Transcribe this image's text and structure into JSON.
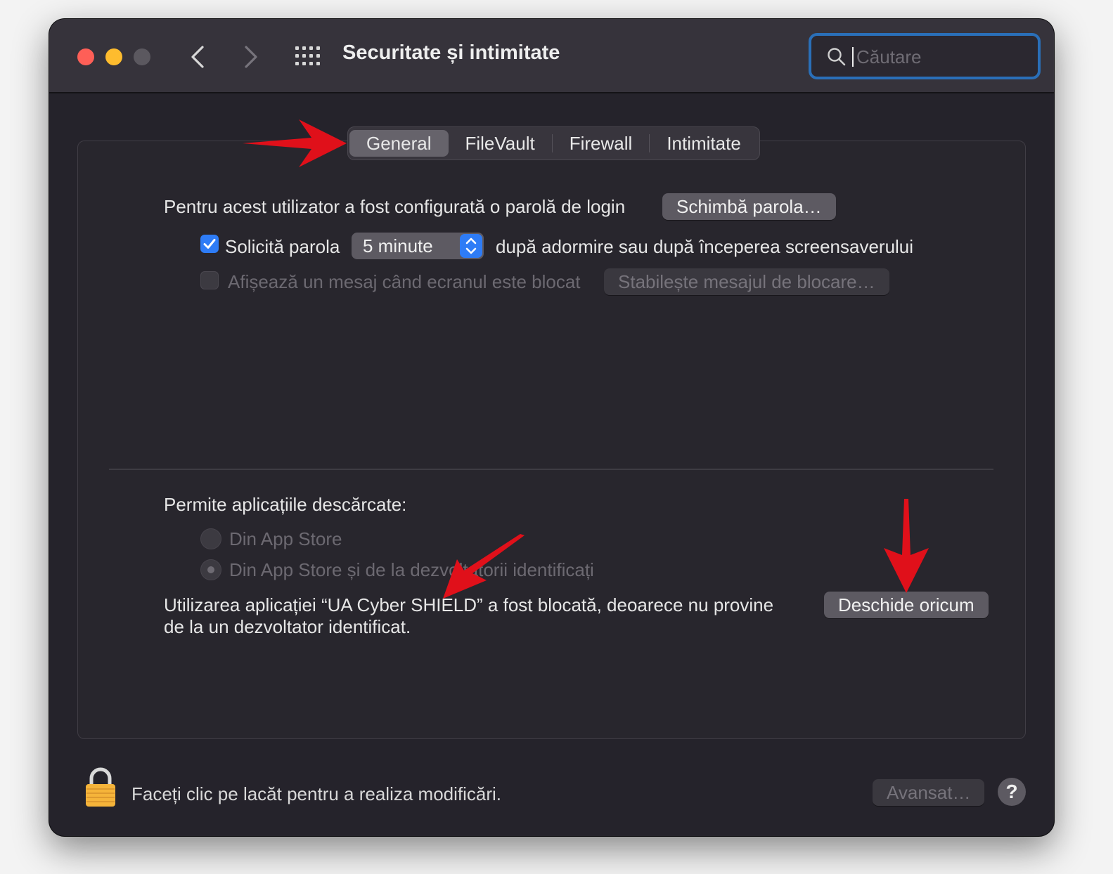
{
  "window": {
    "title": "Securitate și intimitate",
    "search": {
      "placeholder": "Căutare",
      "value": ""
    }
  },
  "tabs": [
    {
      "label": "General",
      "active": true
    },
    {
      "label": "FileVault",
      "active": false
    },
    {
      "label": "Firewall",
      "active": false
    },
    {
      "label": "Intimitate",
      "active": false
    }
  ],
  "general": {
    "login_password_text": "Pentru acest utilizator a fost configurată o parolă de login",
    "change_password_button": "Schimbă parola…",
    "require_password": {
      "checked": true,
      "label": "Solicită parola",
      "delay_value": "5 minute",
      "suffix": "după adormire sau după începerea screensaverului"
    },
    "lock_message": {
      "checked": false,
      "enabled": false,
      "label": "Afișează un mesaj când ecranul este blocat",
      "button": "Stabilește mesajul de blocare…"
    },
    "allow_apps": {
      "heading": "Permite aplicațiile descărcate:",
      "options": [
        {
          "label": "Din App Store",
          "selected": false
        },
        {
          "label": "Din App Store și de la dezvoltatorii identificați",
          "selected": true
        }
      ]
    },
    "blocked_app": {
      "line1": "Utilizarea aplicației “UA Cyber SHIELD” a fost blocată, deoarece nu provine",
      "line2": "de la un dezvoltator identificat.",
      "open_anyway_button": "Deschide oricum"
    }
  },
  "footer": {
    "lock_text": "Faceți clic pe lacăt pentru a realiza modificări.",
    "advanced_button": "Avansat…",
    "help_label": "?"
  },
  "colors": {
    "accent": "#2e7cf6",
    "annotation_arrow": "#e0101a",
    "close": "#fe5f57",
    "minimize": "#febc2e"
  }
}
